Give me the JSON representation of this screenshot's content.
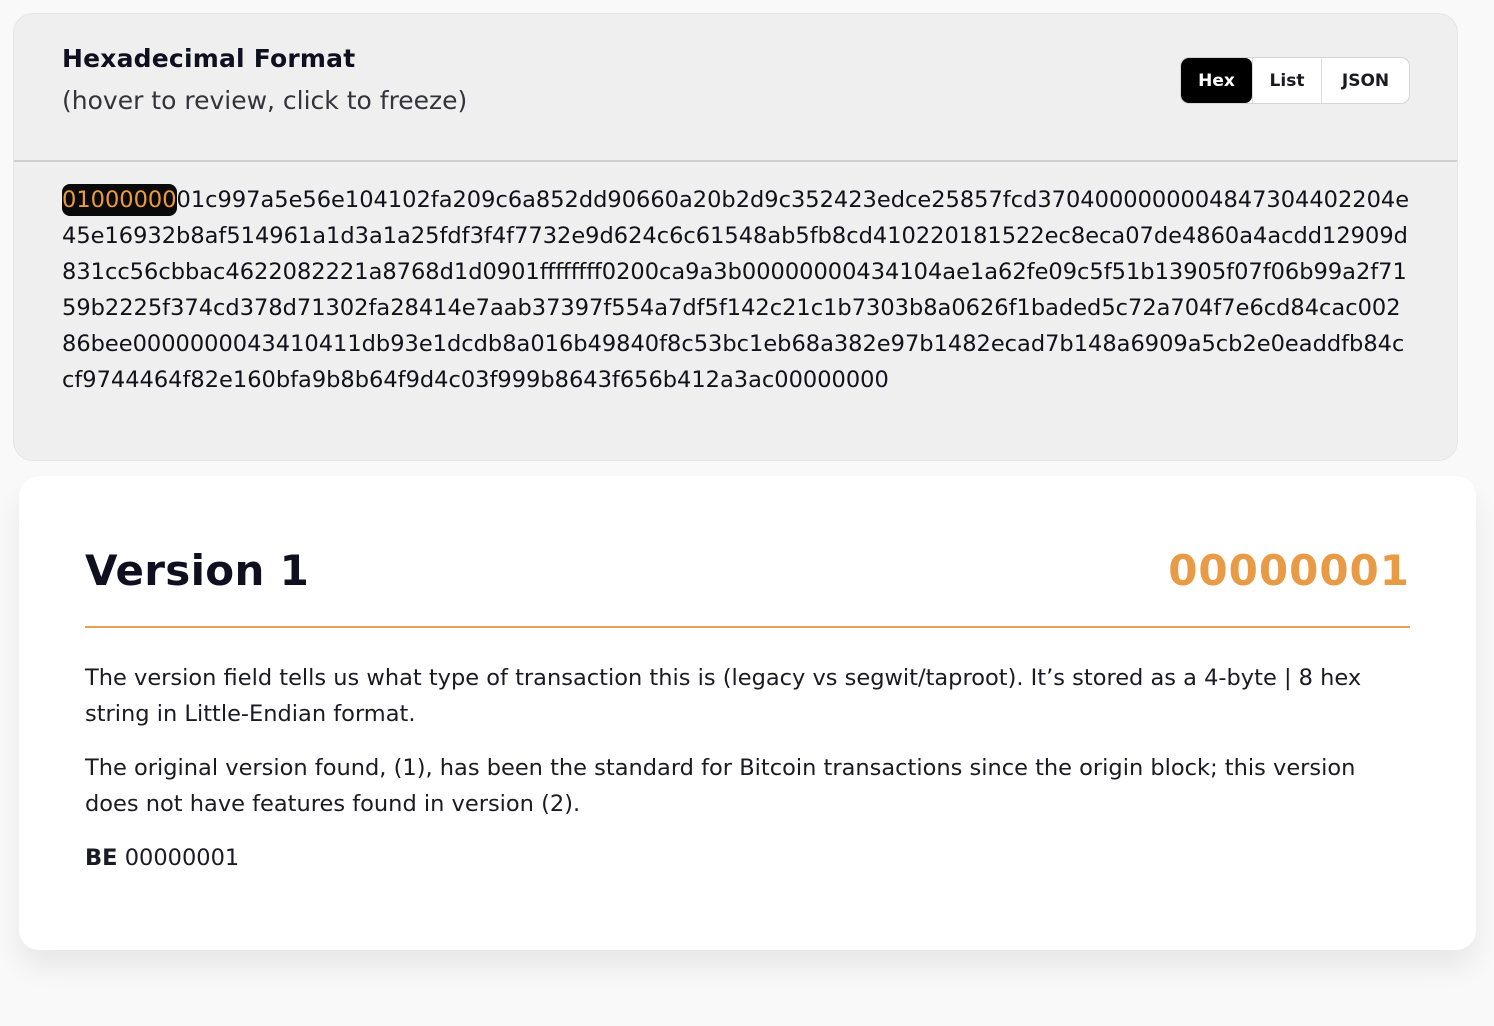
{
  "hex_panel": {
    "title": "Hexadecimal Format",
    "subtitle": "(hover to review, click to freeze)",
    "format_options": [
      "Hex",
      "List",
      "JSON"
    ],
    "active_format": "Hex",
    "highlighted_hex": "01000000",
    "remaining_hex": "01c997a5e56e104102fa209c6a852dd90660a20b2d9c352423edce25857fcd3704000000004847304402204e45e16932b8af514961a1d3a1a25fdf3f4f7732e9d624c6c61548ab5fb8cd410220181522ec8eca07de4860a4acdd12909d831cc56cbbac4622082221a8768d1d0901ffffffff0200ca9a3b00000000434104ae1a62fe09c5f51b13905f07f06b99a2f7159b2225f374cd378d71302fa28414e7aab37397f554a7df5f142c21c1b7303b8a0626f1baded5c72a704f7e6cd84cac00286bee0000000043410411db93e1dcdb8a016b49840f8c53bc1eb68a382e97b1482ecad7b148a6909a5cb2e0eaddfb84ccf9744464f82e160bfa9b8b64f9d4c03f999b8643f656b412a3ac00000000"
  },
  "detail_card": {
    "field_name": "Version 1",
    "field_hex": "00000001",
    "paragraph_1": "The version field tells us what type of transaction this is (legacy vs segwit/taproot). It’s stored as a 4-byte | 8 hex string in Little-Endian format.",
    "paragraph_2": "The original version found, (1), has been the standard for Bitcoin transactions since the origin block; this version does not have features found in version (2).",
    "be_label": "BE",
    "be_value": "00000001"
  },
  "colors": {
    "accent_orange": "#e89a45",
    "highlight_bg": "#0a0a0a",
    "active_toggle_bg": "#000000"
  }
}
